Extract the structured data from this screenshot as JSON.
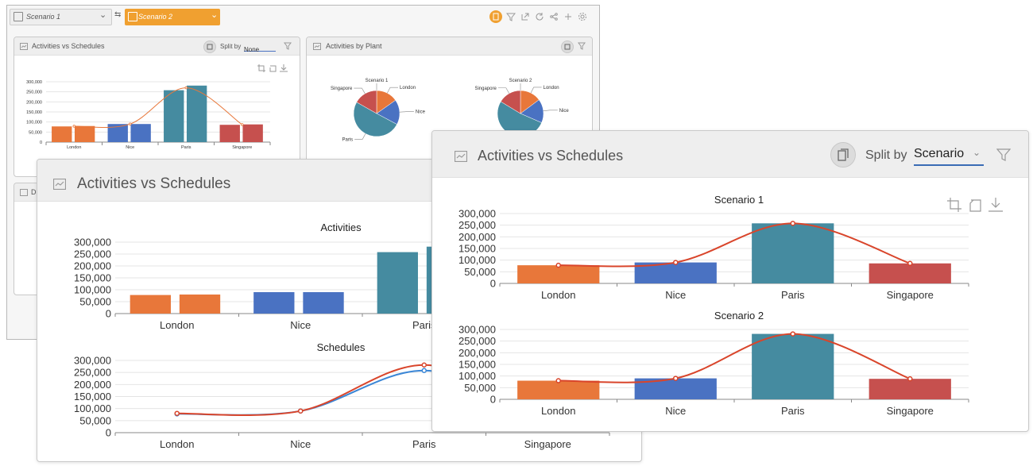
{
  "toolbar": {
    "scenario1_label": "Scenario 1",
    "scenario2_label": "Scenario 2",
    "swap_glyph": "⇆",
    "chevron": "⌄",
    "accent_color": "#f0a030",
    "icons": [
      "copy-icon",
      "filter-icon",
      "external-link-icon",
      "refresh-icon",
      "share-icon",
      "plus-icon",
      "settings-icon"
    ]
  },
  "panel_small_activities": {
    "title": "Activities vs Schedules",
    "split_by_label": "Split by",
    "split_by_value": "None"
  },
  "panel_plant": {
    "title": "Activities by Plant"
  },
  "panel_hidden_title_prefix": "D",
  "panel_large_activities": {
    "title": "Activities vs Schedules"
  },
  "panel_scenario": {
    "title": "Activities vs Schedules",
    "split_by_label": "Split by",
    "split_by_value": "Scenario"
  },
  "colors": {
    "London": "#e8773a",
    "Nice": "#4a72c2",
    "Paris": "#458ba0",
    "Singapore": "#c6504e",
    "line_red": "#d9452b",
    "line_blue": "#3a86d6",
    "line_orange": "#e8773a"
  },
  "chart_data": [
    {
      "id": "small_combo",
      "type": "bar",
      "categories": [
        "London",
        "Nice",
        "Paris",
        "Singapore"
      ],
      "series": [
        {
          "values": [
            78000,
            90000,
            258000,
            86000
          ]
        },
        {
          "values": [
            80000,
            90000,
            281000,
            88000
          ]
        }
      ],
      "line": [
        79000,
        90000,
        270000,
        87000
      ],
      "yticks": [
        "300,000",
        "250,000",
        "200,000",
        "150,000",
        "100,000",
        "50,000",
        "0"
      ],
      "ylim": [
        0,
        300000
      ]
    },
    {
      "id": "pie_scenario1",
      "type": "pie",
      "title": "Scenario 1",
      "categories": [
        "London",
        "Nice",
        "Paris",
        "Singapore"
      ],
      "values": [
        78000,
        90000,
        258000,
        86000
      ]
    },
    {
      "id": "pie_scenario2",
      "type": "pie",
      "title": "Scenario 2",
      "categories": [
        "London",
        "Nice",
        "Paris",
        "Singapore"
      ],
      "values": [
        80000,
        90000,
        281000,
        88000
      ]
    },
    {
      "id": "activities",
      "type": "bar",
      "title": "Activities",
      "categories": [
        "London",
        "Nice",
        "Paris",
        "Singapore"
      ],
      "series": [
        {
          "values": [
            78000,
            90000,
            258000,
            86000
          ]
        },
        {
          "values": [
            80000,
            90000,
            281000,
            88000
          ]
        }
      ],
      "yticks": [
        "300,000",
        "250,000",
        "200,000",
        "150,000",
        "100,000",
        "50,000",
        "0"
      ],
      "ylim": [
        0,
        300000
      ]
    },
    {
      "id": "schedules",
      "type": "line",
      "title": "Schedules",
      "categories": [
        "London",
        "Nice",
        "Paris",
        "Singapore"
      ],
      "series": [
        {
          "values": [
            78000,
            90000,
            258000,
            86000
          ]
        },
        {
          "values": [
            80000,
            90000,
            281000,
            88000
          ]
        }
      ],
      "yticks": [
        "300,000",
        "250,000",
        "200,000",
        "150,000",
        "100,000",
        "50,000",
        "0"
      ],
      "ylim": [
        0,
        300000
      ]
    },
    {
      "id": "scenario1",
      "type": "bar",
      "title": "Scenario 1",
      "categories": [
        "London",
        "Nice",
        "Paris",
        "Singapore"
      ],
      "values": [
        78000,
        90000,
        258000,
        86000
      ],
      "line": [
        78000,
        90000,
        258000,
        86000
      ],
      "yticks": [
        "300,000",
        "250,000",
        "200,000",
        "150,000",
        "100,000",
        "50,000",
        "0"
      ],
      "ylim": [
        0,
        300000
      ]
    },
    {
      "id": "scenario2",
      "type": "bar",
      "title": "Scenario 2",
      "categories": [
        "London",
        "Nice",
        "Paris",
        "Singapore"
      ],
      "values": [
        80000,
        90000,
        281000,
        88000
      ],
      "line": [
        80000,
        90000,
        281000,
        88000
      ],
      "yticks": [
        "300,000",
        "250,000",
        "200,000",
        "150,000",
        "100,000",
        "50,000",
        "0"
      ],
      "ylim": [
        0,
        300000
      ]
    }
  ]
}
